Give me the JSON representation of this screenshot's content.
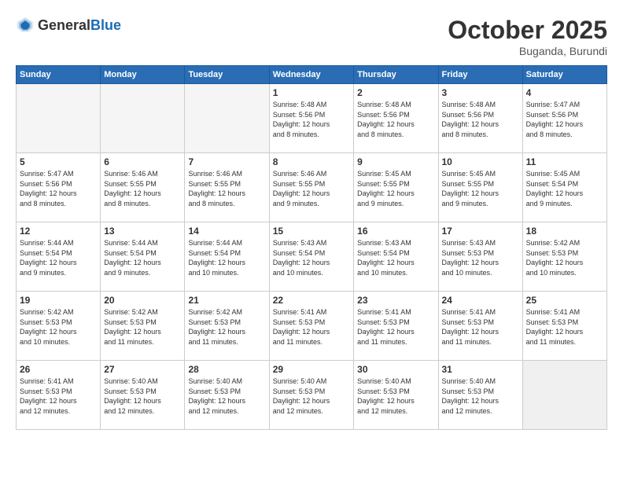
{
  "header": {
    "logo_general": "General",
    "logo_blue": "Blue",
    "month_title": "October 2025",
    "subtitle": "Buganda, Burundi"
  },
  "weekdays": [
    "Sunday",
    "Monday",
    "Tuesday",
    "Wednesday",
    "Thursday",
    "Friday",
    "Saturday"
  ],
  "weeks": [
    [
      {
        "day": "",
        "info": ""
      },
      {
        "day": "",
        "info": ""
      },
      {
        "day": "",
        "info": ""
      },
      {
        "day": "1",
        "info": "Sunrise: 5:48 AM\nSunset: 5:56 PM\nDaylight: 12 hours\nand 8 minutes."
      },
      {
        "day": "2",
        "info": "Sunrise: 5:48 AM\nSunset: 5:56 PM\nDaylight: 12 hours\nand 8 minutes."
      },
      {
        "day": "3",
        "info": "Sunrise: 5:48 AM\nSunset: 5:56 PM\nDaylight: 12 hours\nand 8 minutes."
      },
      {
        "day": "4",
        "info": "Sunrise: 5:47 AM\nSunset: 5:56 PM\nDaylight: 12 hours\nand 8 minutes."
      }
    ],
    [
      {
        "day": "5",
        "info": "Sunrise: 5:47 AM\nSunset: 5:56 PM\nDaylight: 12 hours\nand 8 minutes."
      },
      {
        "day": "6",
        "info": "Sunrise: 5:46 AM\nSunset: 5:55 PM\nDaylight: 12 hours\nand 8 minutes."
      },
      {
        "day": "7",
        "info": "Sunrise: 5:46 AM\nSunset: 5:55 PM\nDaylight: 12 hours\nand 8 minutes."
      },
      {
        "day": "8",
        "info": "Sunrise: 5:46 AM\nSunset: 5:55 PM\nDaylight: 12 hours\nand 9 minutes."
      },
      {
        "day": "9",
        "info": "Sunrise: 5:45 AM\nSunset: 5:55 PM\nDaylight: 12 hours\nand 9 minutes."
      },
      {
        "day": "10",
        "info": "Sunrise: 5:45 AM\nSunset: 5:55 PM\nDaylight: 12 hours\nand 9 minutes."
      },
      {
        "day": "11",
        "info": "Sunrise: 5:45 AM\nSunset: 5:54 PM\nDaylight: 12 hours\nand 9 minutes."
      }
    ],
    [
      {
        "day": "12",
        "info": "Sunrise: 5:44 AM\nSunset: 5:54 PM\nDaylight: 12 hours\nand 9 minutes."
      },
      {
        "day": "13",
        "info": "Sunrise: 5:44 AM\nSunset: 5:54 PM\nDaylight: 12 hours\nand 9 minutes."
      },
      {
        "day": "14",
        "info": "Sunrise: 5:44 AM\nSunset: 5:54 PM\nDaylight: 12 hours\nand 10 minutes."
      },
      {
        "day": "15",
        "info": "Sunrise: 5:43 AM\nSunset: 5:54 PM\nDaylight: 12 hours\nand 10 minutes."
      },
      {
        "day": "16",
        "info": "Sunrise: 5:43 AM\nSunset: 5:54 PM\nDaylight: 12 hours\nand 10 minutes."
      },
      {
        "day": "17",
        "info": "Sunrise: 5:43 AM\nSunset: 5:53 PM\nDaylight: 12 hours\nand 10 minutes."
      },
      {
        "day": "18",
        "info": "Sunrise: 5:42 AM\nSunset: 5:53 PM\nDaylight: 12 hours\nand 10 minutes."
      }
    ],
    [
      {
        "day": "19",
        "info": "Sunrise: 5:42 AM\nSunset: 5:53 PM\nDaylight: 12 hours\nand 10 minutes."
      },
      {
        "day": "20",
        "info": "Sunrise: 5:42 AM\nSunset: 5:53 PM\nDaylight: 12 hours\nand 11 minutes."
      },
      {
        "day": "21",
        "info": "Sunrise: 5:42 AM\nSunset: 5:53 PM\nDaylight: 12 hours\nand 11 minutes."
      },
      {
        "day": "22",
        "info": "Sunrise: 5:41 AM\nSunset: 5:53 PM\nDaylight: 12 hours\nand 11 minutes."
      },
      {
        "day": "23",
        "info": "Sunrise: 5:41 AM\nSunset: 5:53 PM\nDaylight: 12 hours\nand 11 minutes."
      },
      {
        "day": "24",
        "info": "Sunrise: 5:41 AM\nSunset: 5:53 PM\nDaylight: 12 hours\nand 11 minutes."
      },
      {
        "day": "25",
        "info": "Sunrise: 5:41 AM\nSunset: 5:53 PM\nDaylight: 12 hours\nand 11 minutes."
      }
    ],
    [
      {
        "day": "26",
        "info": "Sunrise: 5:41 AM\nSunset: 5:53 PM\nDaylight: 12 hours\nand 12 minutes."
      },
      {
        "day": "27",
        "info": "Sunrise: 5:40 AM\nSunset: 5:53 PM\nDaylight: 12 hours\nand 12 minutes."
      },
      {
        "day": "28",
        "info": "Sunrise: 5:40 AM\nSunset: 5:53 PM\nDaylight: 12 hours\nand 12 minutes."
      },
      {
        "day": "29",
        "info": "Sunrise: 5:40 AM\nSunset: 5:53 PM\nDaylight: 12 hours\nand 12 minutes."
      },
      {
        "day": "30",
        "info": "Sunrise: 5:40 AM\nSunset: 5:53 PM\nDaylight: 12 hours\nand 12 minutes."
      },
      {
        "day": "31",
        "info": "Sunrise: 5:40 AM\nSunset: 5:53 PM\nDaylight: 12 hours\nand 12 minutes."
      },
      {
        "day": "",
        "info": ""
      }
    ]
  ]
}
